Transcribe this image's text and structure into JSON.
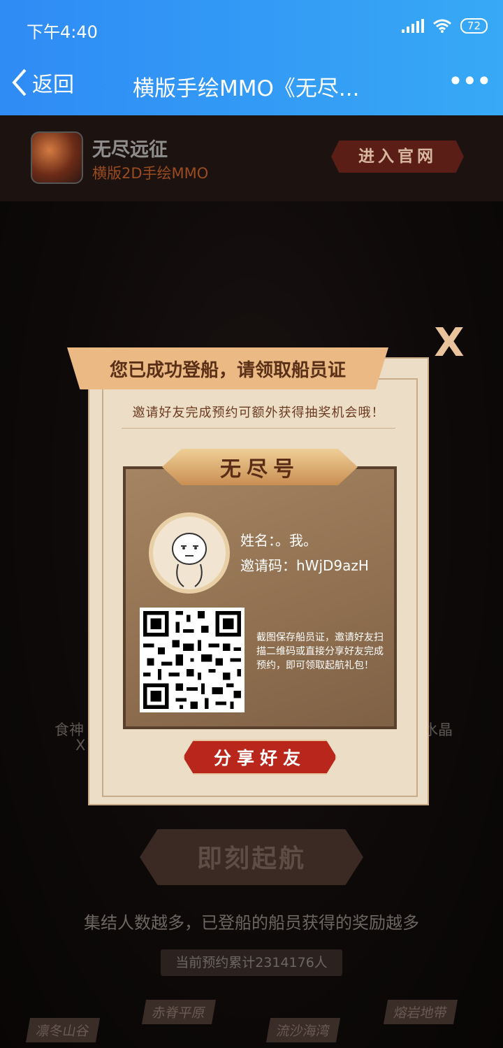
{
  "status": {
    "time": "下午4:40",
    "battery": "72"
  },
  "nav": {
    "back_label": "返回",
    "title": "横版手绘MMO《无尽...",
    "more": "•••"
  },
  "app": {
    "name": "无尽远征",
    "subtitle": "横版2D手绘MMO",
    "official_button": "进入官网"
  },
  "background": {
    "banner": "即刻起航",
    "subtitle": "集结人数越多，已登船的船员获得的奖励越多",
    "count": "当前预约累计2314176人",
    "left_label_1": "食神",
    "left_label_2": "X",
    "right_label": "水晶",
    "regions": [
      "凛冬山谷",
      "赤脊平原",
      "流沙海湾",
      "熔岩地带"
    ]
  },
  "modal": {
    "close": "X",
    "ribbon": "您已成功登船，请领取船员证",
    "invite_text": "邀请好友完成预约可额外获得抽奖机会哦！",
    "ship_name": "无尽号",
    "name_line": "姓名：。我。",
    "code_line": "邀请码：hWjD9azH",
    "note": "截图保存船员证，邀请好友扫描二维码或直接分享好友完成预约，即可领取起航礼包！",
    "share_button": "分享好友"
  }
}
